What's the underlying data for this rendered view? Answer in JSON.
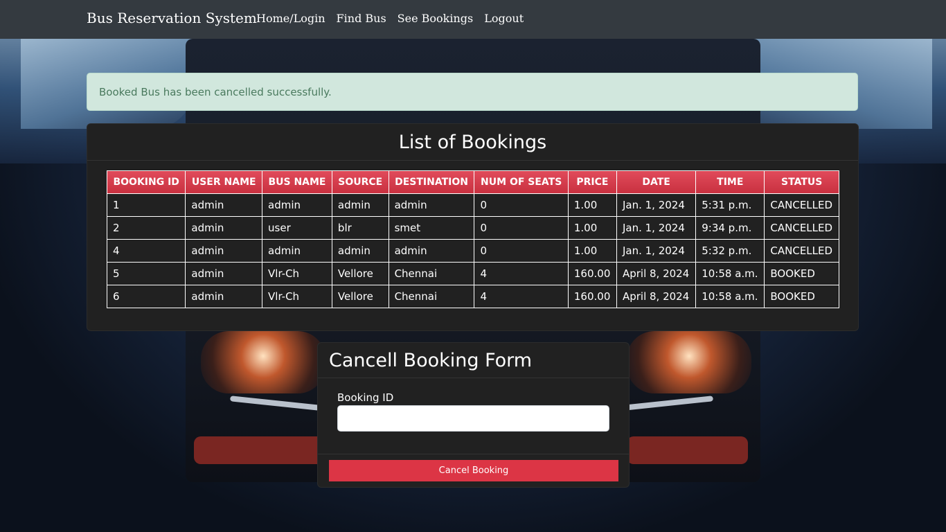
{
  "navbar": {
    "brand": "Bus Reservation System",
    "links": [
      "Home/Login",
      "Find Bus",
      "See Bookings",
      "Logout"
    ]
  },
  "alert": {
    "message": "Booked Bus has been cancelled successfully."
  },
  "bookings": {
    "title": "List of Bookings",
    "columns": [
      "BOOKING ID",
      "USER NAME",
      "BUS NAME",
      "SOURCE",
      "DESTINATION",
      "NUM OF SEATS",
      "PRICE",
      "DATE",
      "TIME",
      "STATUS"
    ],
    "rows": [
      [
        "1",
        "admin",
        "admin",
        "admin",
        "admin",
        "0",
        "1.00",
        "Jan. 1, 2024",
        "5:31 p.m.",
        "CANCELLED"
      ],
      [
        "2",
        "admin",
        "user",
        "blr",
        "smet",
        "0",
        "1.00",
        "Jan. 1, 2024",
        "9:34 p.m.",
        "CANCELLED"
      ],
      [
        "4",
        "admin",
        "admin",
        "admin",
        "admin",
        "0",
        "1.00",
        "Jan. 1, 2024",
        "5:32 p.m.",
        "CANCELLED"
      ],
      [
        "5",
        "admin",
        "Vlr-Ch",
        "Vellore",
        "Chennai",
        "4",
        "160.00",
        "April 8, 2024",
        "10:58 a.m.",
        "BOOKED"
      ],
      [
        "6",
        "admin",
        "Vlr-Ch",
        "Vellore",
        "Chennai",
        "4",
        "160.00",
        "April 8, 2024",
        "10:58 a.m.",
        "BOOKED"
      ]
    ]
  },
  "cancel_form": {
    "title": "Cancell Booking Form",
    "booking_id_label": "Booking ID",
    "booking_id_value": "",
    "submit_label": "Cancel Booking"
  },
  "colors": {
    "navbar": "#343a40",
    "alert_bg": "#d1e7dd",
    "alert_text": "#4a7a5e",
    "card_bg": "#212121",
    "danger": "#dc3545"
  }
}
